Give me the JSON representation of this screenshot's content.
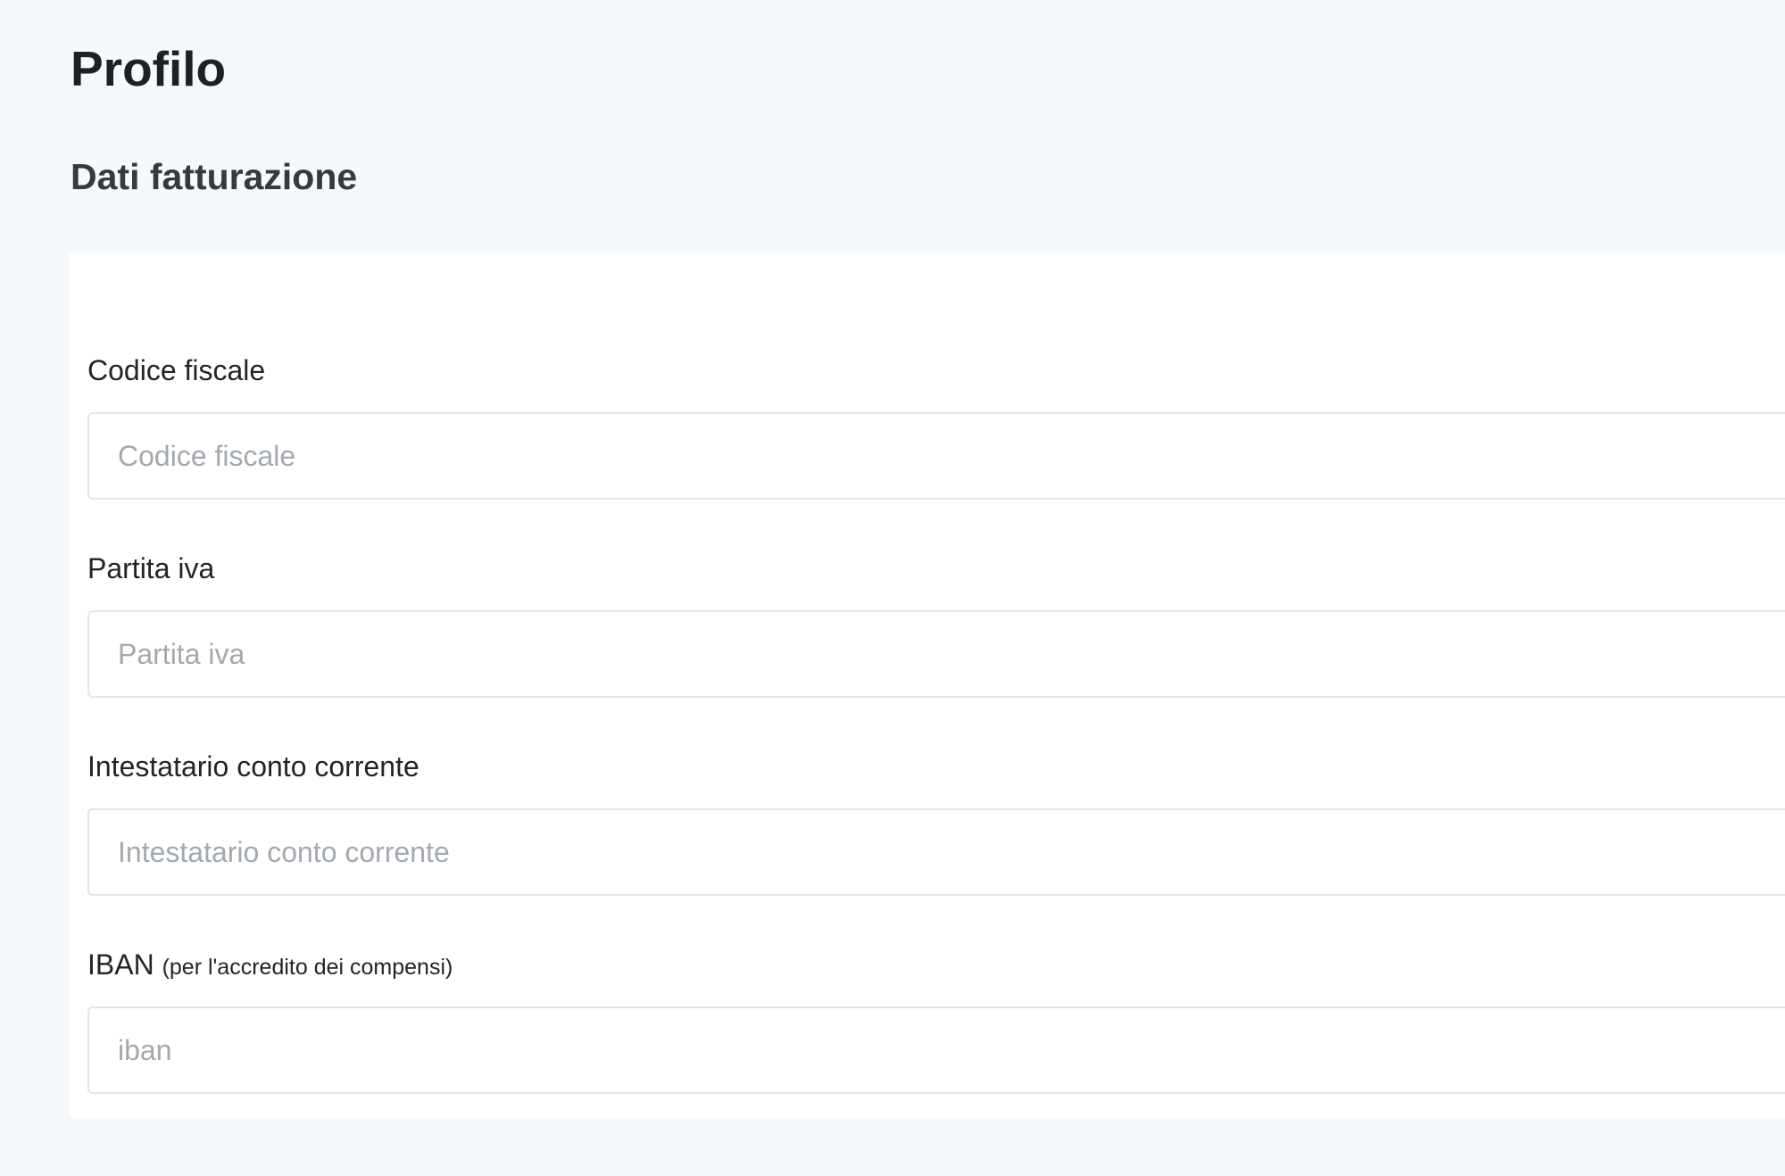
{
  "page": {
    "title": "Profilo"
  },
  "billing": {
    "title": "Dati fatturazione",
    "fields": [
      {
        "label": "Codice fiscale",
        "placeholder": "Codice fiscale",
        "value": ""
      },
      {
        "label": "Partita iva",
        "placeholder": "Partita iva",
        "value": ""
      },
      {
        "label": "Intestatario conto corrente",
        "placeholder": "Intestatario conto corrente",
        "value": ""
      },
      {
        "label": "IBAN",
        "label_note": "(per l'accredito dei compensi)",
        "placeholder": "iban",
        "value": ""
      }
    ]
  },
  "colors": {
    "page_background": "#f6f9fc",
    "card_background": "#ffffff",
    "input_border": "#e2e6ea",
    "placeholder_text": "#a3a9ae",
    "text": "#212529"
  }
}
